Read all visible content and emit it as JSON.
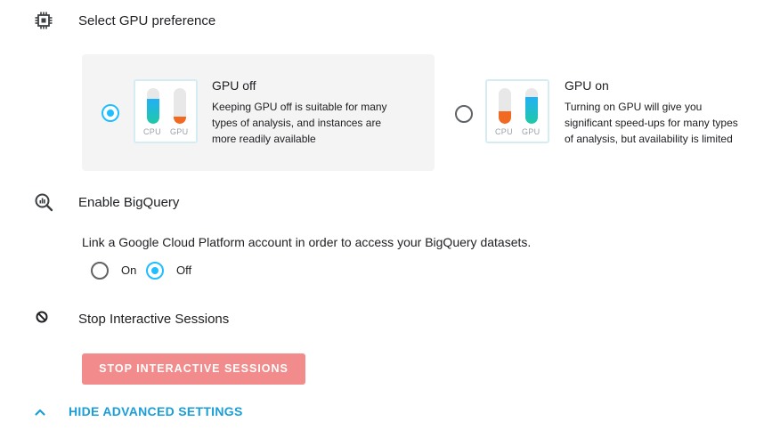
{
  "gpu_section": {
    "title": "Select GPU preference",
    "icon": "chip-icon",
    "options": [
      {
        "title": "GPU off",
        "selected": true,
        "description_lines": [
          "Keeping GPU off is suitable for many",
          "types of analysis, and instances are",
          "more readily available"
        ],
        "cpu_label": "CPU",
        "gpu_label": "GPU",
        "cpu_level": 0.7,
        "gpu_level": 0.2
      },
      {
        "title": "GPU on",
        "selected": false,
        "description_lines": [
          "Turning on GPU will give you",
          "significant speed-ups for many types",
          "of analysis, but availability is limited"
        ],
        "cpu_label": "CPU",
        "gpu_label": "GPU",
        "cpu_level": 0.35,
        "gpu_level": 0.75
      }
    ]
  },
  "bigquery_section": {
    "title": "Enable BigQuery",
    "icon": "bigquery-icon",
    "description": "Link a Google Cloud Platform account in order to access your BigQuery datasets.",
    "options": [
      {
        "label": "On",
        "selected": false
      },
      {
        "label": "Off",
        "selected": true
      }
    ]
  },
  "sessions_section": {
    "title": "Stop Interactive Sessions",
    "icon": "block-icon",
    "button_label": "STOP INTERACTIVE SESSIONS"
  },
  "advanced": {
    "label": "HIDE ADVANCED SETTINGS",
    "icon": "chevron-up-icon"
  },
  "colors": {
    "accent": "#20beff",
    "link": "#1a9ed8",
    "danger_button": "#f28b8b",
    "orange": "#f26a21"
  }
}
